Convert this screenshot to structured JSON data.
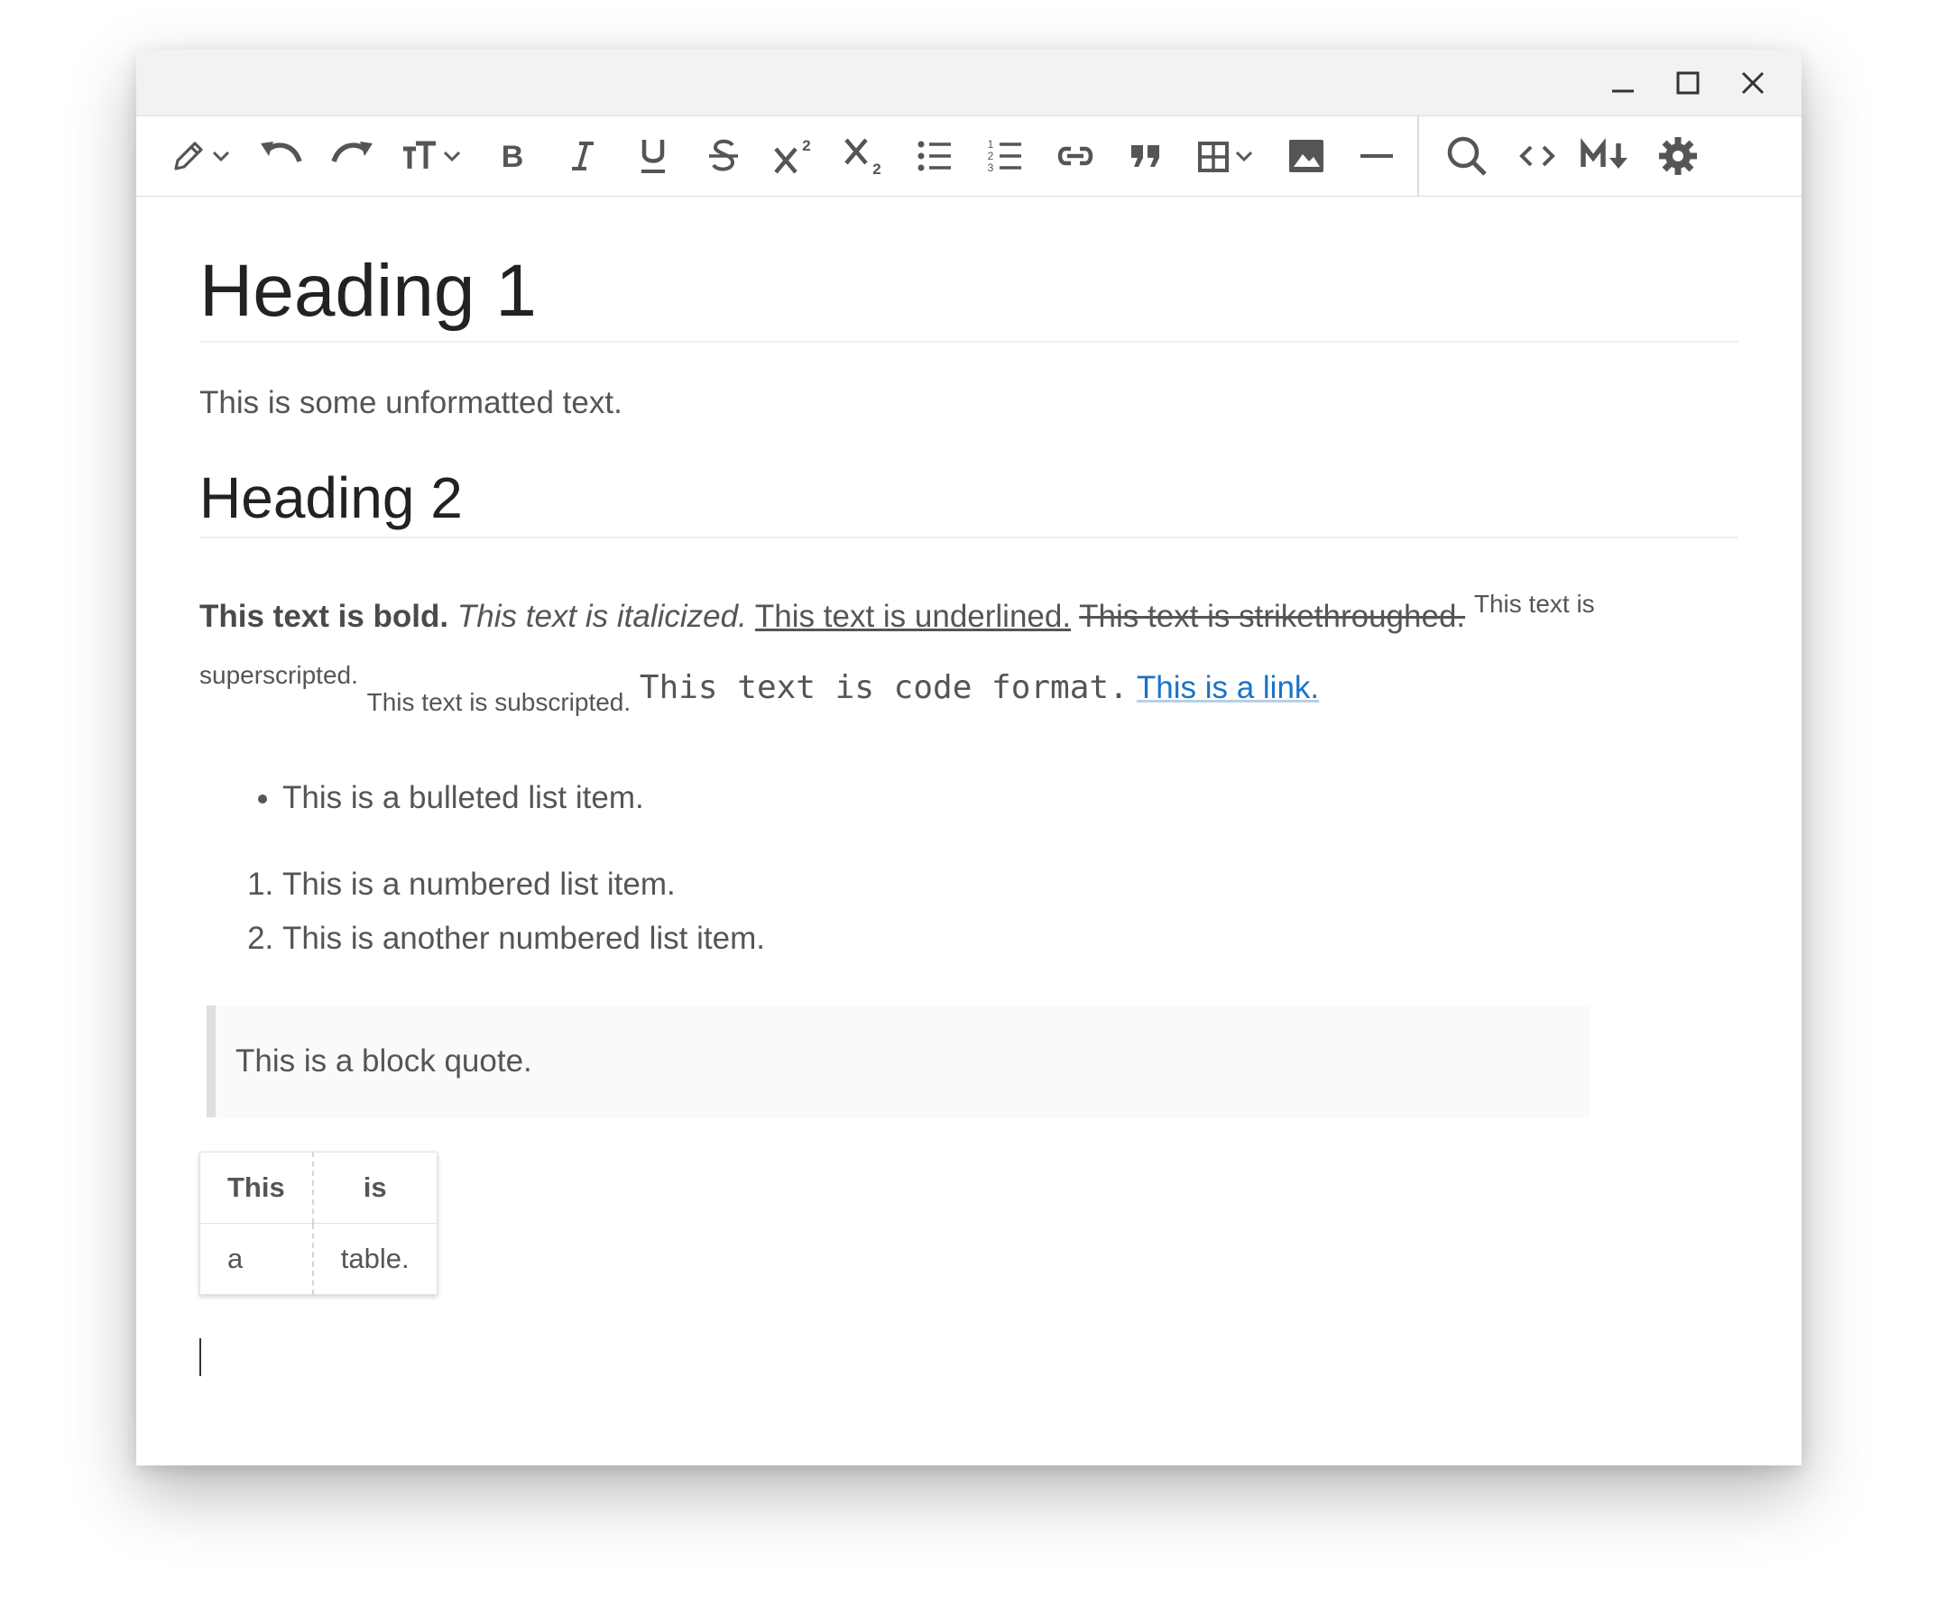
{
  "window_controls": {
    "minimize_icon": "minimize-icon",
    "maximize_icon": "maximize-icon",
    "close_icon": "close-icon"
  },
  "toolbar": {
    "icons": [
      "pencil-icon",
      "undo-icon",
      "redo-icon",
      "text-size-icon",
      "bold-icon",
      "italic-icon",
      "underline-icon",
      "strikethrough-icon",
      "superscript-icon",
      "subscript-icon",
      "bulleted-list-icon",
      "numbered-list-icon",
      "link-icon",
      "quote-icon",
      "table-icon",
      "image-icon",
      "horizontal-rule-icon",
      "search-icon",
      "code-view-icon",
      "markdown-icon",
      "settings-icon"
    ],
    "icon_color": "#555555"
  },
  "document": {
    "heading1": "Heading 1",
    "paragraph1": "This is some unformatted text.",
    "heading2": "Heading 2",
    "bold_text": "This text is bold.",
    "italic_text": "This text is italicized.",
    "underline_text": "This text is underlined.",
    "strike_text": "This text is strikethroughed.",
    "superscript_text": "This text is superscripted.",
    "subscript_text": "This text is subscripted.",
    "code_text": "This text is code format.",
    "link_text": "This is a link.",
    "bullet_items": [
      "This is a bulleted list item."
    ],
    "numbered_items": [
      "This is a numbered list item.",
      "This is another numbered list item."
    ],
    "blockquote": "This is a block quote.",
    "table": {
      "headers": [
        "This",
        "is"
      ],
      "rows": [
        [
          "a",
          "table."
        ]
      ]
    }
  },
  "colors": {
    "link": "#1a73c8",
    "heading": "#222222",
    "body_text": "#555555"
  }
}
